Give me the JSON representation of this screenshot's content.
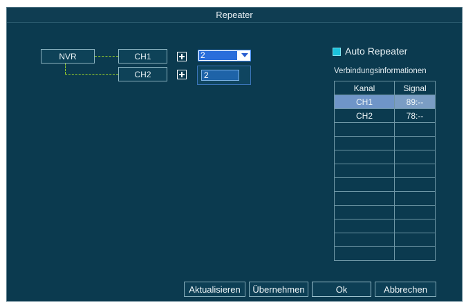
{
  "window": {
    "title": "Repeater"
  },
  "topology": {
    "root_label": "NVR",
    "channels": [
      {
        "label": "CH1",
        "repeater_value": "2",
        "control": "dropdown"
      },
      {
        "label": "CH2",
        "repeater_value": "2",
        "control": "input"
      }
    ]
  },
  "auto_repeater": {
    "label": "Auto Repeater",
    "checked": true,
    "color": "#1cc2dc"
  },
  "connection_info": {
    "label": "Verbindungsinformationen",
    "columns": [
      "Kanal",
      "Signal"
    ],
    "rows": [
      {
        "kanal": "CH1",
        "signal": "89:--",
        "selected": true
      },
      {
        "kanal": "CH2",
        "signal": "78:--",
        "selected": false
      },
      {
        "kanal": "",
        "signal": ""
      },
      {
        "kanal": "",
        "signal": ""
      },
      {
        "kanal": "",
        "signal": ""
      },
      {
        "kanal": "",
        "signal": ""
      },
      {
        "kanal": "",
        "signal": ""
      },
      {
        "kanal": "",
        "signal": ""
      },
      {
        "kanal": "",
        "signal": ""
      },
      {
        "kanal": "",
        "signal": ""
      },
      {
        "kanal": "",
        "signal": ""
      },
      {
        "kanal": "",
        "signal": ""
      }
    ]
  },
  "buttons": {
    "refresh": "Aktualisieren",
    "apply": "Übernehmen",
    "ok": "Ok",
    "cancel": "Abbrechen"
  },
  "colors": {
    "background": "#0b3a4f",
    "dashed_line": "#9bd12a",
    "selection": "#6f95c8"
  }
}
